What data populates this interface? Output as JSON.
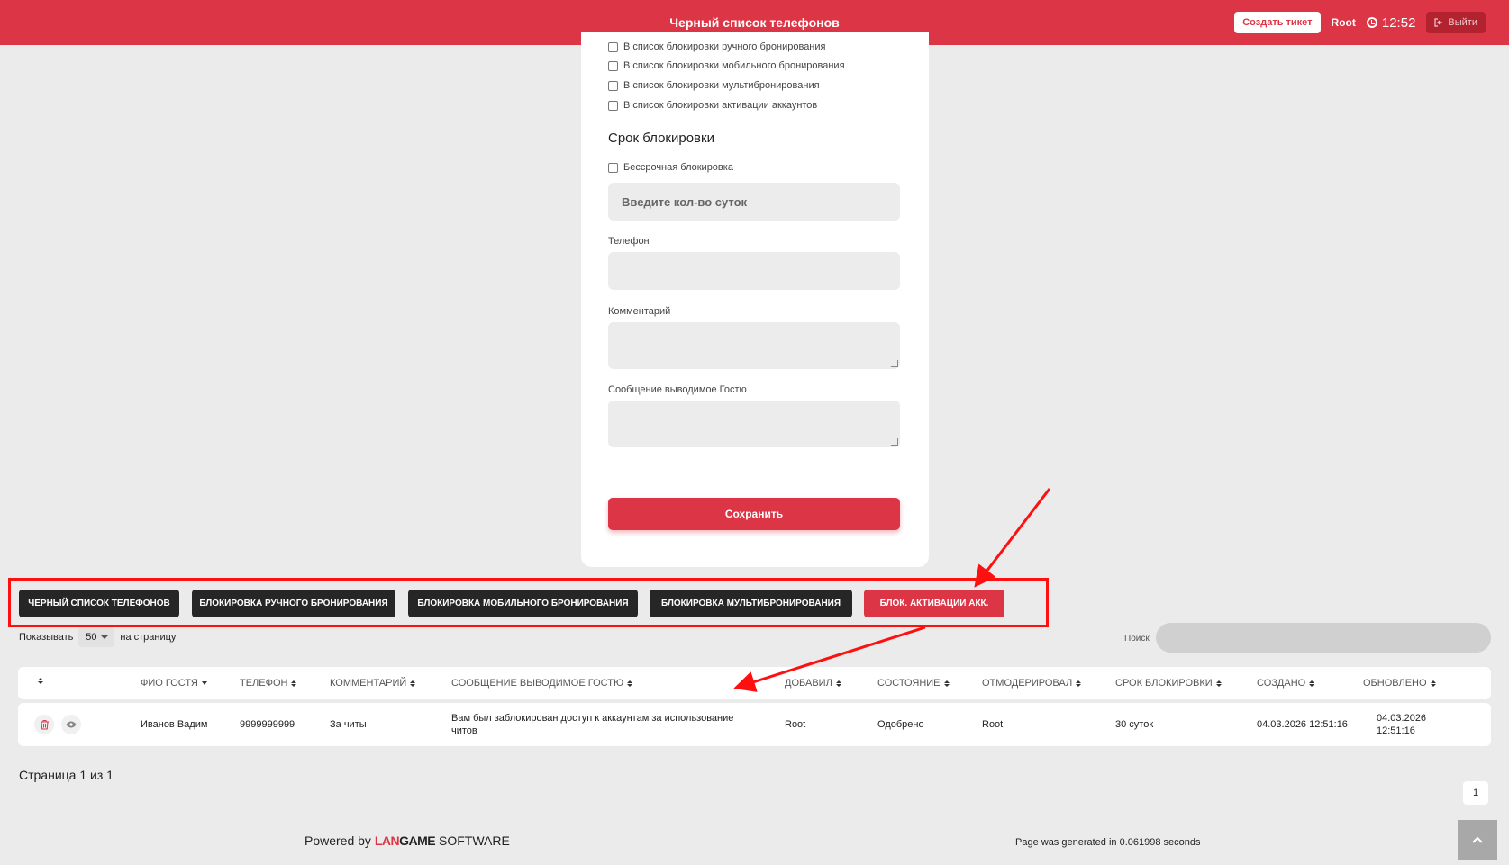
{
  "header": {
    "title": "Черный список телефонов",
    "create_ticket": "Создать тикет",
    "user": "Root",
    "time": "12:52",
    "logout": "Выйти"
  },
  "form": {
    "checkboxes": [
      "В список блокировки ручного бронирования",
      "В список блокировки мобильного бронирования",
      "В список блокировки мультибронирования",
      "В список блокировки активации аккаунтов"
    ],
    "section_title": "Срок блокировки",
    "permanent_label": "Бессрочная блокировка",
    "days_placeholder": "Введите кол-во суток",
    "phone_label": "Телефон",
    "comment_label": "Комментарий",
    "message_label": "Сообщение выводимое Гостю",
    "save": "Сохранить"
  },
  "tabs": [
    {
      "label": "ЧЕРНЫЙ СПИСОК ТЕЛЕФОНОВ",
      "active": false
    },
    {
      "label": "БЛОКИРОВКА РУЧНОГО БРОНИРОВАНИЯ",
      "active": false
    },
    {
      "label": "БЛОКИРОВКА МОБИЛЬНОГО БРОНИРОВАНИЯ",
      "active": false
    },
    {
      "label": "БЛОКИРОВКА МУЛЬТИБРОНИРОВАНИЯ",
      "active": false
    },
    {
      "label": "БЛОК. АКТИВАЦИИ АКК.",
      "active": true
    }
  ],
  "table_controls": {
    "show_label": "Показывать",
    "per_page": "50",
    "per_page_suffix": "на страницу",
    "search_label": "Поиск"
  },
  "table": {
    "columns": [
      "ФИО ГОСТЯ",
      "ТЕЛЕФОН",
      "КОММЕНТАРИЙ",
      "СООБЩЕНИЕ ВЫВОДИМОЕ ГОСТЮ",
      "ДОБАВИЛ",
      "СОСТОЯНИЕ",
      "ОТМОДЕРИРОВАЛ",
      "СРОК БЛОКИРОВКИ",
      "СОЗДАНО",
      "ОБНОВЛЕНО"
    ],
    "rows": [
      {
        "name": "Иванов Вадим",
        "phone": "9999999999",
        "comment": "За читы",
        "message": "Вам был заблокирован доступ к аккаунтам за использование читов",
        "added_by": "Root",
        "status": "Одобрено",
        "moderated_by": "Root",
        "term": "30 суток",
        "created": "04.03.2026 12:51:16",
        "updated": "04.03.2026 12:51:16"
      }
    ]
  },
  "pager": {
    "info": "Страница 1 из 1",
    "current": "1"
  },
  "footer": {
    "powered_by": "Powered by",
    "brand_lan": "LAN",
    "brand_game": "GAME",
    "brand_software": "SOFTWARE",
    "generated": "Page was generated in 0.061998 seconds"
  },
  "colors": {
    "accent": "#dc3545",
    "dark_tab": "#262626",
    "annotation": "#ff1010"
  }
}
